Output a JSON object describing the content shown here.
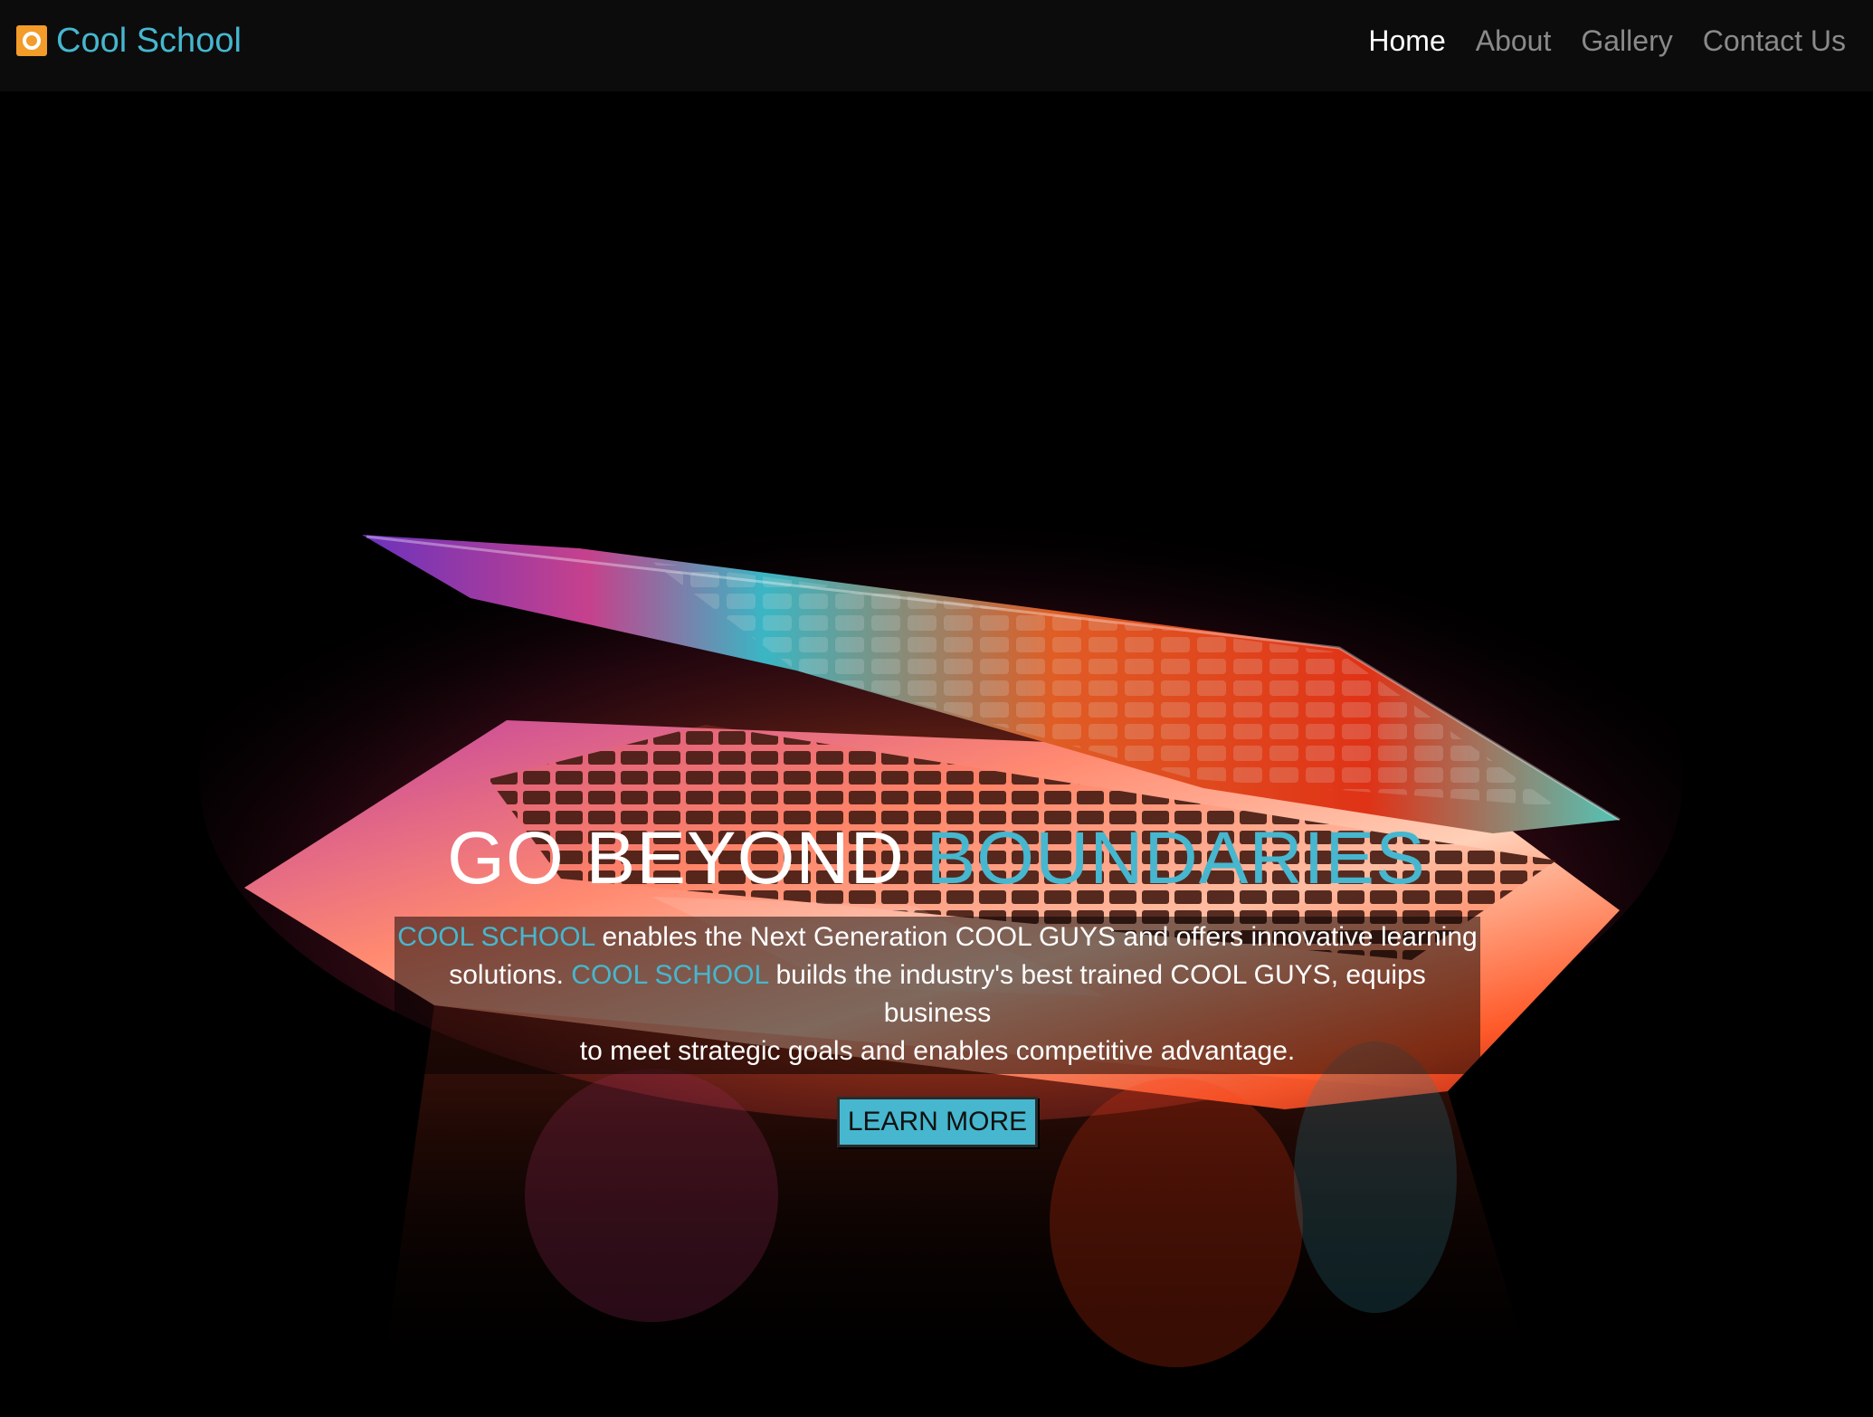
{
  "brand": {
    "name": "Cool School",
    "logo_icon": "cool-school-logo-icon",
    "color": "#46b7cf",
    "logo_color": "#f39c2a"
  },
  "nav": {
    "items": [
      {
        "label": "Home",
        "active": true
      },
      {
        "label": "About",
        "active": false
      },
      {
        "label": "Gallery",
        "active": false
      },
      {
        "label": "Contact Us",
        "active": false
      }
    ]
  },
  "hero": {
    "background": "glowing-laptop-photo",
    "headline_part1": "GO BEYOND ",
    "headline_part2": "BOUNDARIES",
    "description": {
      "line1_accent": "COOL SCHOOL",
      "line1_rest": " enables the Next Generation COOL GUYS and offers innovative learning",
      "line2_start": "solutions. ",
      "line2_accent": "COOL SCHOOL",
      "line2_rest": " builds the industry's best trained COOL GUYS, equips business",
      "line3": "to meet strategic goals and enables competitive advantage."
    },
    "cta_label": "LEARN MORE"
  }
}
